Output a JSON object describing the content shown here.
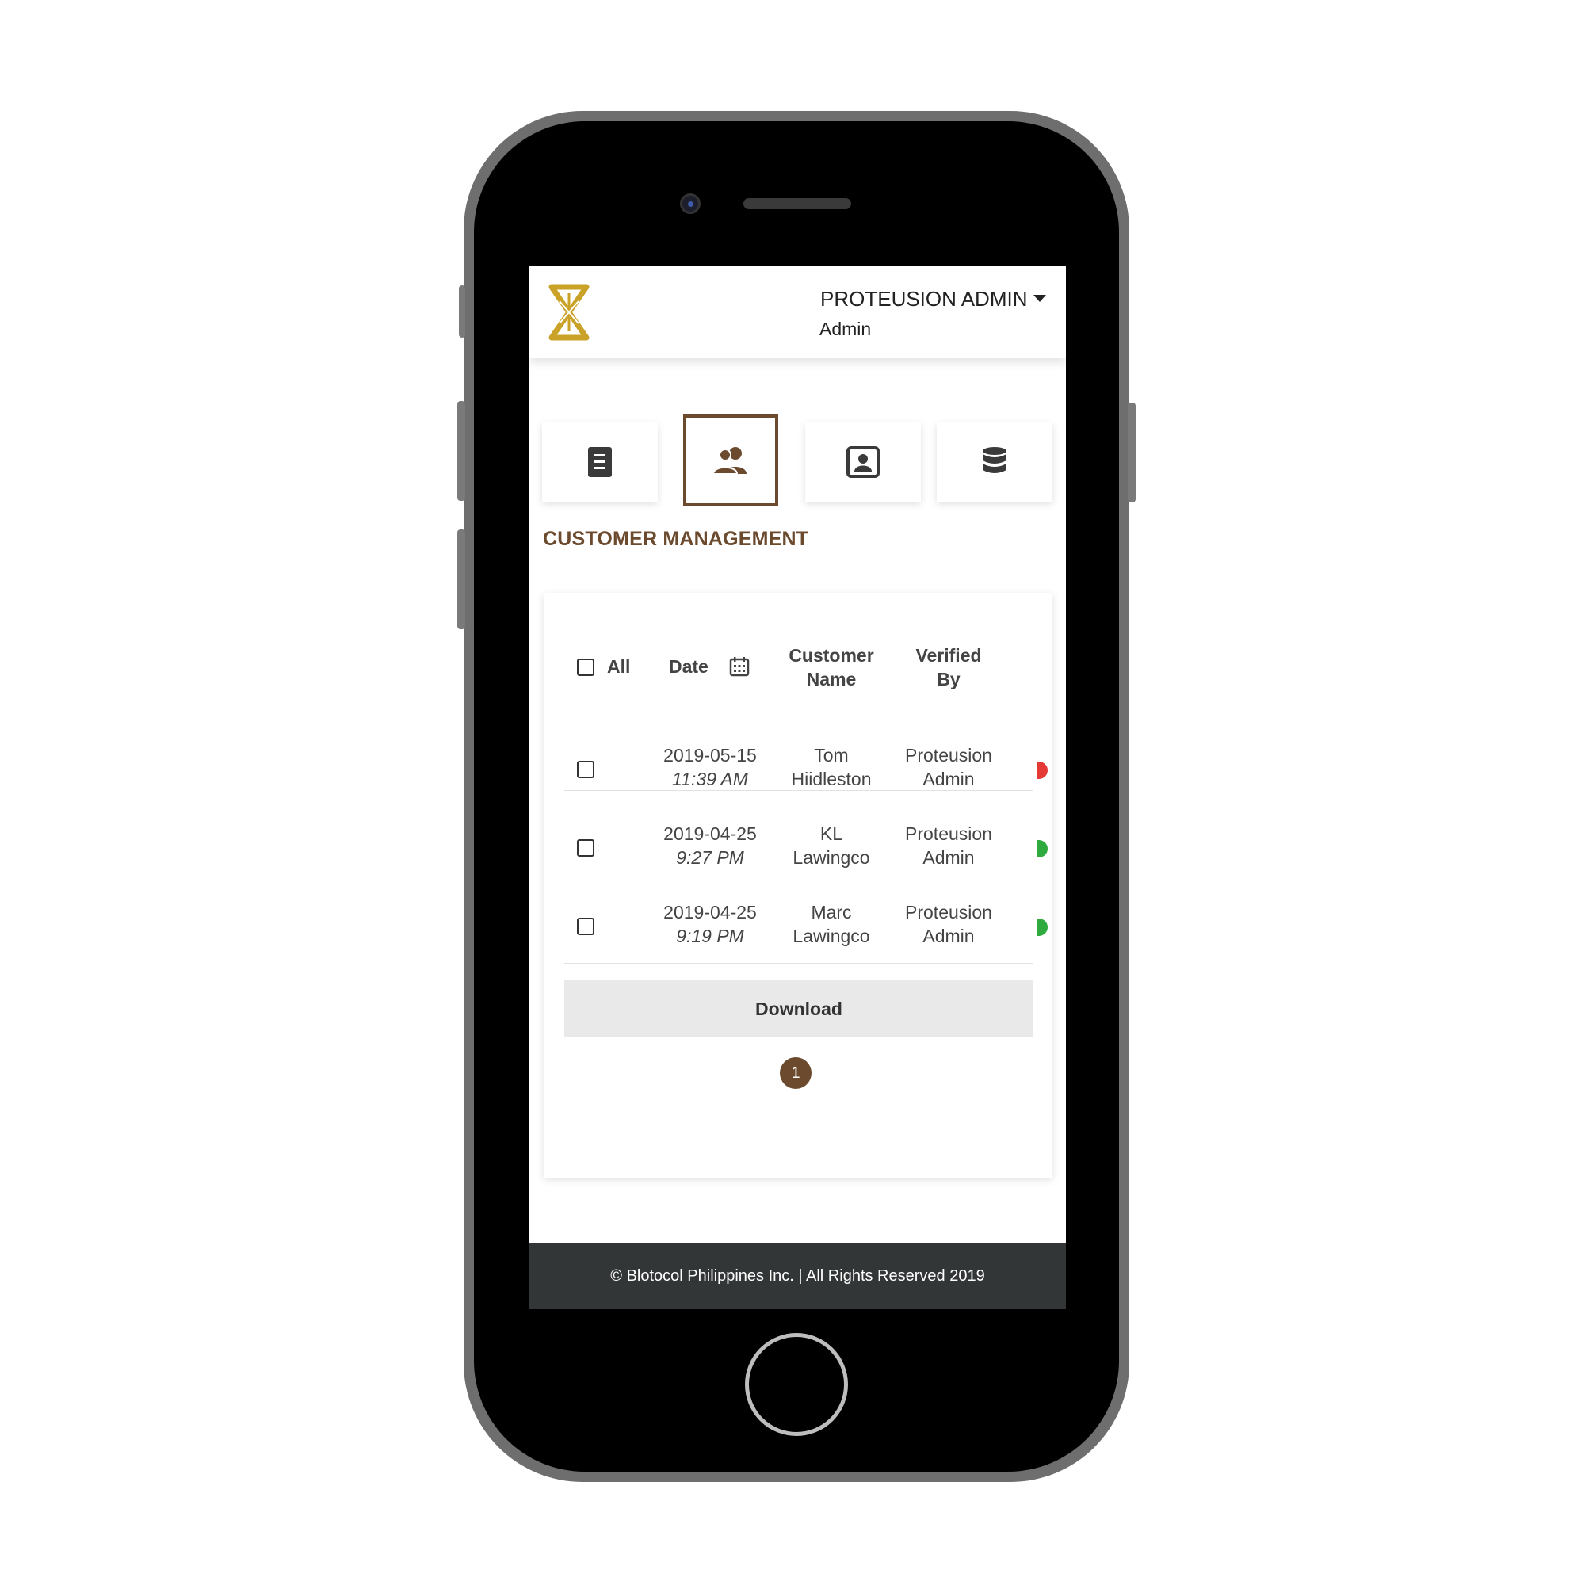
{
  "header": {
    "user_name": "PROTEUSION ADMIN",
    "user_role": "Admin"
  },
  "tabs": [
    {
      "icon": "document-icon",
      "active": false
    },
    {
      "icon": "users-icon",
      "active": true
    },
    {
      "icon": "contact-card-icon",
      "active": false
    },
    {
      "icon": "database-icon",
      "active": false
    }
  ],
  "section_title": "CUSTOMER MANAGEMENT",
  "table": {
    "columns": {
      "select_all": "All",
      "date": "Date",
      "customer_name_1": "Customer",
      "customer_name_2": "Name",
      "verified_by_1": "Verified",
      "verified_by_2": "By"
    },
    "rows": [
      {
        "date": "2019-05-15",
        "time": "11:39 AM",
        "name_1": "Tom",
        "name_2": "Hiidleston",
        "verified_1": "Proteusion",
        "verified_2": "Admin",
        "status_color": "#e53935"
      },
      {
        "date": "2019-04-25",
        "time": "9:27 PM",
        "name_1": "KL",
        "name_2": "Lawingco",
        "verified_1": "Proteusion",
        "verified_2": "Admin",
        "status_color": "#2eaa3f"
      },
      {
        "date": "2019-04-25",
        "time": "9:19 PM",
        "name_1": "Marc",
        "name_2": "Lawingco",
        "verified_1": "Proteusion",
        "verified_2": "Admin",
        "status_color": "#2eaa3f"
      }
    ]
  },
  "download_label": "Download",
  "pagination": {
    "current_page": "1"
  },
  "footer_text": "© Blotocol Philippines Inc. | All Rights Reserved 2019",
  "colors": {
    "accent": "#6b4a2e",
    "logo_gold": "#c9a227",
    "footer_bg": "#333637"
  }
}
